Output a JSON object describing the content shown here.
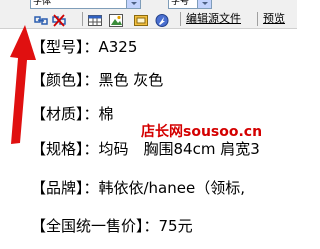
{
  "toolbar": {
    "font_select_value": "字体",
    "size_select_value": "字号",
    "edit_source_label": "编辑源文件",
    "preview_label": "预览"
  },
  "content": {
    "lines": [
      "【型号】：A325",
      "【颜色】：黑色 灰色",
      "【材质】：棉",
      "【规格】：均码　胸围84cm 肩宽3",
      "【品牌】：韩依依/hanee（领标,",
      "【全国统一售价】：75元"
    ]
  },
  "watermark": {
    "text": "店长网sousoo.cn"
  },
  "colors": {
    "arrow": "#e01010",
    "watermark": "#d40000"
  }
}
